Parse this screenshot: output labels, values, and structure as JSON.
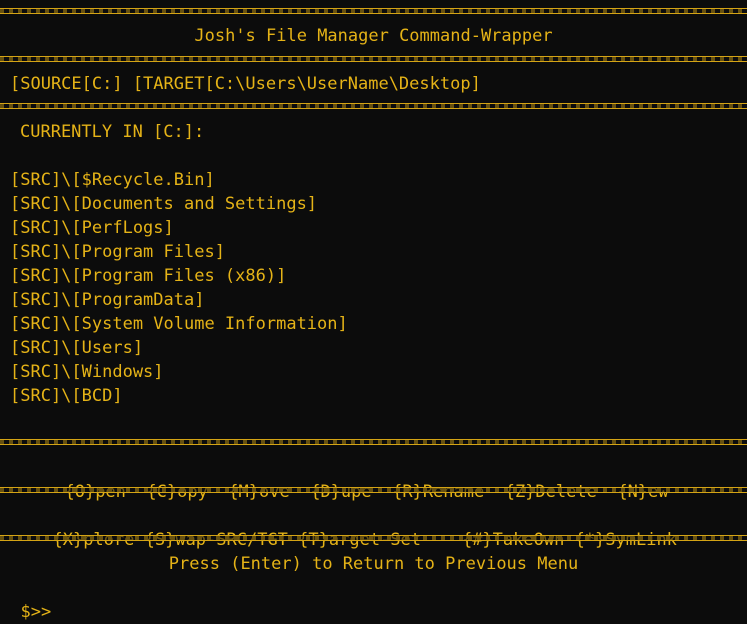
{
  "title": "Josh's File Manager Command-Wrapper",
  "status_line": "[SOURCE[C:] [TARGET[C:\\Users\\UserName\\Desktop]",
  "current_location": "CURRENTLY IN [C:]:",
  "entries": [
    "[SRC]\\[$Recycle.Bin]",
    "[SRC]\\[Documents and Settings]",
    "[SRC]\\[PerfLogs]",
    "[SRC]\\[Program Files]",
    "[SRC]\\[Program Files (x86)]",
    "[SRC]\\[ProgramData]",
    "[SRC]\\[System Volume Information]",
    "[SRC]\\[Users]",
    "[SRC]\\[Windows]",
    "[SRC]\\[BCD]"
  ],
  "menu_row1": [
    "{O}pen",
    "{C}opy",
    "{M}ove",
    "{D}upe",
    "{R}Rename",
    "{Z}Delete",
    "{N}ew"
  ],
  "menu_row2": [
    "{X}plore",
    "{S}wap-SRC/TGT",
    "{T}arget-Set",
    "{#}TakeOwn",
    "{*}SymLink"
  ],
  "footer_hint": "Press (Enter) to Return to Previous Menu",
  "prompt": "$>>",
  "colors": {
    "background": "#0c0c0c",
    "text": "#e5b317"
  }
}
